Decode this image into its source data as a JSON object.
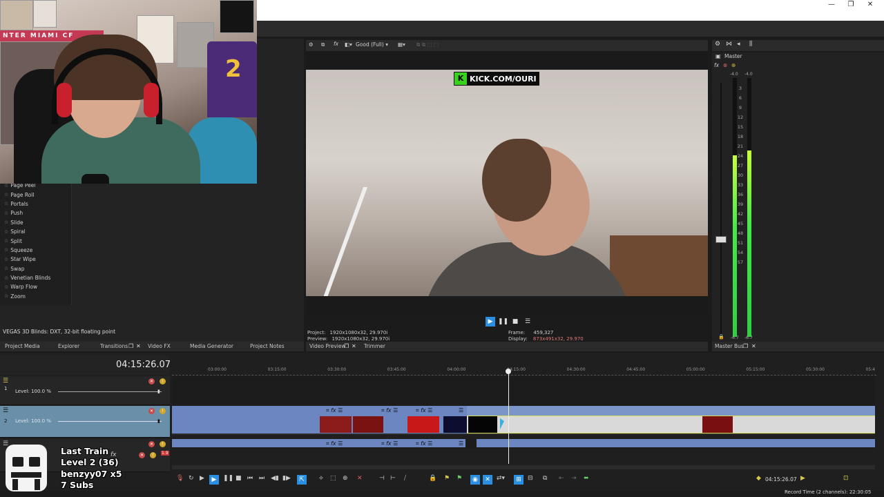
{
  "window": {
    "minimize": "—",
    "restore": "❐",
    "close": "✕"
  },
  "effects_list": [
    "Page Peel",
    "Page Roll",
    "Portals",
    "Push",
    "Slide",
    "Spiral",
    "Split",
    "Squeeze",
    "Star Wipe",
    "Swap",
    "Venetian Blinds",
    "Warp Flow",
    "Zoom"
  ],
  "left_status": "VEGAS 3D Blinds: DXT, 32-bit floating point",
  "left_tabs": [
    "Project Media",
    "Explorer",
    "Transitions",
    "Video FX",
    "Media Generator",
    "Project Notes"
  ],
  "preview": {
    "quality": "Good (Full)",
    "watermark": "KICK.COM/OURI",
    "project_label": "Project:",
    "project_value": "1920x1080x32, 29.970i",
    "preview_label": "Preview:",
    "preview_value": "1920x1080x32, 29.970i",
    "frame_label": "Frame:",
    "frame_value": "459,327",
    "display_label": "Display:",
    "display_value": "873x491x32, 29.970",
    "tabs": [
      "Video Preview",
      "Trimmer"
    ]
  },
  "master": {
    "title": "Master",
    "scale_top_left": "-4.0",
    "scale_top_right": "-4.0",
    "scale": [
      "3",
      "6",
      "9",
      "12",
      "15",
      "18",
      "21",
      "24",
      "27",
      "30",
      "33",
      "36",
      "39",
      "42",
      "45",
      "48",
      "51",
      "54",
      "57"
    ],
    "bottom_left": "-6.7",
    "bottom_right": "-6.7",
    "tab": "Master Bus",
    "level_left": 0.7,
    "level_right": 0.72
  },
  "webcam": {
    "banner": "NTER MIAMI CF",
    "jersey_number": "2"
  },
  "timeline": {
    "timecode": "04:15:26.07",
    "ruler": [
      "03:00:00",
      "03:15:00",
      "03:30:00",
      "03:45:00",
      "04:00:00",
      "04:15:00",
      "04:30:00",
      "04:45:00",
      "05:00:00",
      "05:15:00",
      "05:30:00",
      "05:4"
    ],
    "track1_level": "Level: 100.0 %",
    "track2_level": "Level: 100.0 %",
    "track_mute_badge": "1.9",
    "bottom_timecode": "04:15:26.07",
    "record_time": "Record Time (2 channels): 22:30:05"
  },
  "overlay": {
    "line1": "Last Train",
    "line2": "Level 2  (36)",
    "line3": "benzyy07 x5",
    "line4": "7 Subs"
  },
  "colors": {
    "accent": "#2a8fe0",
    "clip_blue": "#6b86c0",
    "meter_green": "#46e84a",
    "kick_green": "#38d11e"
  }
}
